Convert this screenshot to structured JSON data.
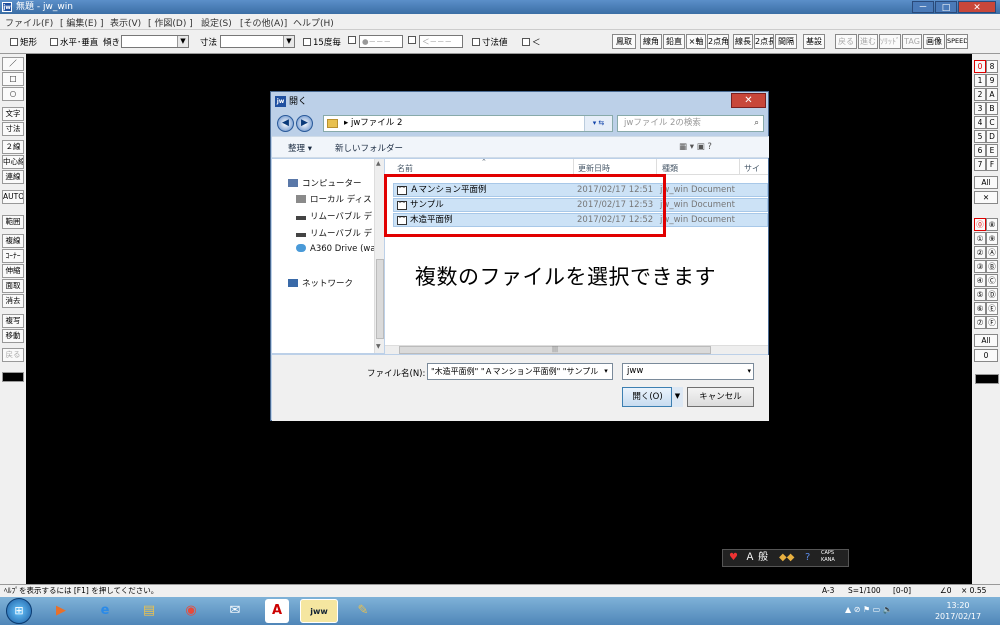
{
  "window": {
    "title": "無題 - jw_win",
    "app_icon_text": "jw",
    "controls": [
      "－",
      "□",
      "✕"
    ]
  },
  "menubar": [
    "ファイル(F)",
    "[ 編集(E) ]",
    "表示(V)",
    "[ 作図(D) ]",
    "設定(S)",
    "[その他(A)]",
    "ヘルプ(H)"
  ],
  "toolbar": {
    "chk_kukei": "矩形",
    "chk_suihei": "水平･垂直",
    "katamuki_label": "傾き",
    "sunpo_label": "寸法",
    "chk_15do": "15度毎",
    "circle_combo": "●－－－",
    "arrow_combo": "＜－－－",
    "chk_sunpochi": "寸法値",
    "chk_lt": "＜",
    "buttons": [
      "鳳取",
      "線角",
      "鉛直",
      "×軸",
      "2点角",
      "線長",
      "2点長",
      "間隔",
      "基設"
    ],
    "buttons_dim": [
      "戻る",
      "進む",
      "ｿﾘｯﾄﾞ",
      "TAG"
    ],
    "buttons_right": [
      "画像",
      "SPEED"
    ]
  },
  "left_palette": [
    "／",
    "□",
    "○",
    "文字",
    "寸法",
    "２線",
    "中心線",
    "連線",
    "AUTO",
    "範囲",
    "複線",
    "ｺｰﾅｰ",
    "伸縮",
    "面取",
    "消去",
    "複写",
    "移動",
    "戻る"
  ],
  "right_palette": {
    "group1": [
      [
        "0",
        "8"
      ],
      [
        "1",
        "9"
      ],
      [
        "2",
        "A"
      ],
      [
        "3",
        "B"
      ],
      [
        "4",
        "C"
      ],
      [
        "5",
        "D"
      ],
      [
        "6",
        "E"
      ],
      [
        "7",
        "F"
      ]
    ],
    "all1": "All",
    "x_btn": "✕",
    "group2": [
      [
        "⓪",
        "⑧"
      ],
      [
        "①",
        "⑨"
      ],
      [
        "②",
        "Ⓐ"
      ],
      [
        "③",
        "Ⓑ"
      ],
      [
        "④",
        "Ⓒ"
      ],
      [
        "⑤",
        "Ⓓ"
      ],
      [
        "⑥",
        "Ⓔ"
      ],
      [
        "⑦",
        "Ⓕ"
      ]
    ],
    "all2": "All",
    "zero": "0"
  },
  "dialog": {
    "title": "開く",
    "app_icon_text": "jw",
    "close": "✕",
    "back": "◀",
    "forward": "▶",
    "address_path": "▸  jwファイル 2",
    "search_placeholder": "jwファイル 2の検索",
    "search_icon": "⌕",
    "organize": "整理 ▾",
    "new_folder": "新しいフォルダー",
    "view_icons": "▦ ▾   ▣   ?",
    "nav": [
      {
        "label": "コンピューター",
        "icon": "computer-icon",
        "color": "#5a78a8"
      },
      {
        "label": "ローカル ディス",
        "icon": "local-disk-icon",
        "color": "#8a8a8a"
      },
      {
        "label": "リムーバブル デ",
        "icon": "removable-disk-icon",
        "color": "#444444"
      },
      {
        "label": "リムーバブル デ",
        "icon": "removable-disk-icon",
        "color": "#444444"
      },
      {
        "label": "A360 Drive (wa",
        "icon": "cloud-drive-icon",
        "color": "#4a9ad8"
      },
      {
        "label": "ネットワーク",
        "icon": "network-icon",
        "color": "#3a6aa8"
      }
    ],
    "columns": [
      "名前",
      "更新日時",
      "種類",
      "サイ"
    ],
    "files": [
      {
        "name": "Ａマンション平面例",
        "date": "2017/02/17 12:51",
        "type": "jw_win Document"
      },
      {
        "name": "サンプル",
        "date": "2017/02/17 12:53",
        "type": "jw_win Document"
      },
      {
        "name": "木造平面例",
        "date": "2017/02/17 12:52",
        "type": "jw_win Document"
      }
    ],
    "annotation": "複数のファイルを選択できます",
    "filename_label": "ファイル名(N):",
    "filename_value": "\"木造平面例\" \"Ａマンション平面例\" \"サンプル",
    "filetype_value": "jww",
    "open_button": "開く(O)",
    "cancel_button": "キャンセル"
  },
  "imebar": {
    "mode": "Ａ 般",
    "caps": "CAPS\nKANA"
  },
  "statusbar": {
    "help": "ﾍﾙﾌﾟを表示するには [F1] を押してください。",
    "paper": "A-3",
    "scale": "S=1/100",
    "layer": "[0-0]",
    "angle": "∠0",
    "factor": "× 0.55"
  },
  "taskbar": {
    "time": "13:20",
    "date": "2017/02/17",
    "tray": "▲  ⊘  ⚑  ▭  🔈"
  },
  "colors": {
    "accent_red": "#e10000",
    "selection": "#cce2f6",
    "titlebar": "#3b6ea5"
  }
}
